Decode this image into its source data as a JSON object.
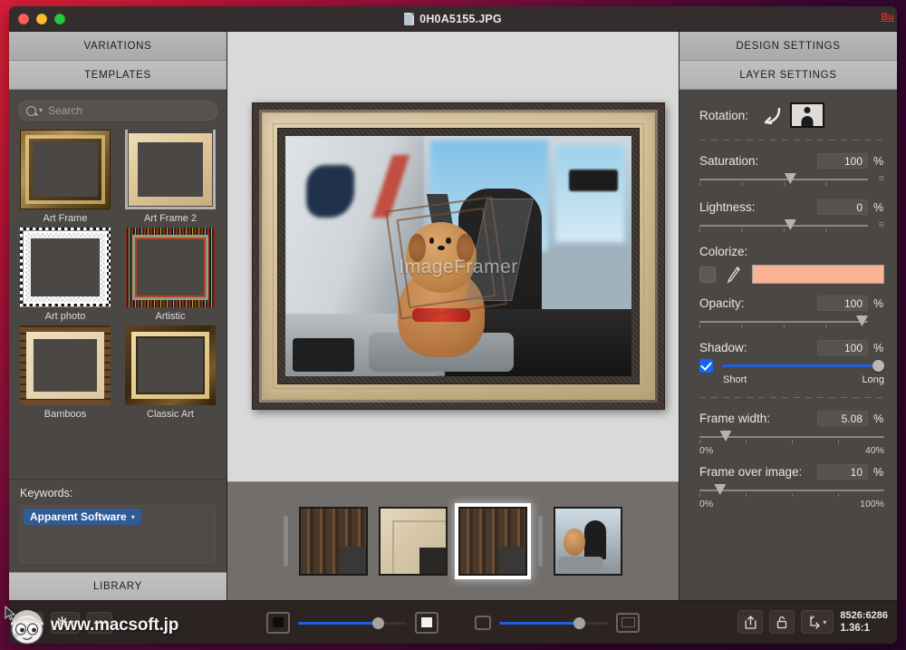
{
  "window": {
    "title": "0H0A5155.JPG",
    "badge": "Bu",
    "traffic": [
      "close",
      "minimize",
      "zoom"
    ]
  },
  "left_panel": {
    "tabs": [
      {
        "label": "VARIATIONS",
        "selected": false
      },
      {
        "label": "TEMPLATES",
        "selected": true
      }
    ],
    "search": {
      "placeholder": "Search",
      "value": ""
    },
    "templates": [
      {
        "label": "Art Frame",
        "style": "gold"
      },
      {
        "label": "Art Frame 2",
        "style": "cream"
      },
      {
        "label": "Art photo",
        "style": "white"
      },
      {
        "label": "Artistic",
        "style": "stripe"
      },
      {
        "label": "Bamboos",
        "style": "bamboo"
      },
      {
        "label": "Classic Art",
        "style": "classic"
      }
    ],
    "keywords": {
      "label": "Keywords:",
      "tokens": [
        "Apparent Software"
      ]
    },
    "library_button": "LIBRARY"
  },
  "canvas": {
    "watermark": "ImageFramer"
  },
  "filmstrip": {
    "items": [
      {
        "name": "frame-thumb-dark-1",
        "selected": false
      },
      {
        "name": "frame-thumb-light",
        "selected": false
      },
      {
        "name": "frame-thumb-dark-2",
        "selected": true
      },
      {
        "name": "photo-thumb",
        "selected": false
      }
    ]
  },
  "right_panel": {
    "tabs": [
      {
        "label": "DESIGN SETTINGS",
        "selected": false
      },
      {
        "label": "LAYER SETTINGS",
        "selected": true
      }
    ],
    "rotation": {
      "label": "Rotation:",
      "icons": [
        "rotate-ccw-icon",
        "landscape-orientation-icon"
      ]
    },
    "saturation": {
      "label": "Saturation:",
      "value": "100",
      "unit": "%",
      "slider_pct": 50
    },
    "lightness": {
      "label": "Lightness:",
      "value": "0",
      "unit": "%",
      "slider_pct": 50
    },
    "colorize": {
      "label": "Colorize:",
      "checkbox": false,
      "swatch_color": "#F9B392"
    },
    "opacity": {
      "label": "Opacity:",
      "value": "100",
      "unit": "%",
      "slider_pct": 100
    },
    "shadow": {
      "label": "Shadow:",
      "value": "100",
      "unit": "%",
      "checkbox": true,
      "slider_pct": 100,
      "min_label": "Short",
      "max_label": "Long",
      "accent_color": "#1f5fe0"
    },
    "frame_width": {
      "label": "Frame width:",
      "value": "5.08",
      "unit": "%",
      "slider_pct": 12,
      "min_label": "0%",
      "max_label": "40%"
    },
    "frame_over_image": {
      "label": "Frame over image:",
      "value": "10",
      "unit": "%",
      "slider_pct": 10,
      "min_label": "0%",
      "max_label": "100%"
    }
  },
  "bottom_bar": {
    "buttons": [
      "add-button",
      "settings-gear-button",
      "remove-button"
    ],
    "zoom_left": {
      "slider_pct": 72
    },
    "zoom_right": {
      "slider_pct": 72
    },
    "actions": [
      "share-icon",
      "lock-icon",
      "aspect-ratio-icon"
    ],
    "dimensions": "8526:6286",
    "ratio": "1.36:1"
  },
  "overlay": {
    "site_watermark": "www.macsoft.jp"
  }
}
